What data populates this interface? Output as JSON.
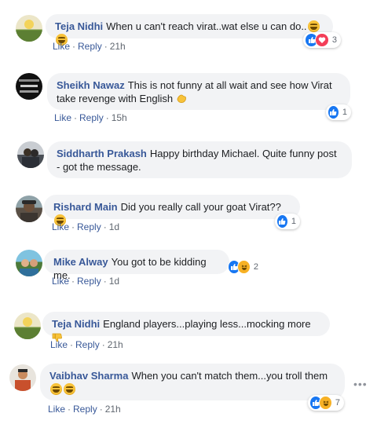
{
  "comments": [
    {
      "author": "Teja Nidhi",
      "text": "When u can't reach virat..wat else u can do..",
      "emoji_suffix": [
        "grinning-sweat",
        "grinning-sweat"
      ],
      "like": "Like",
      "reply": "Reply",
      "time": "21h",
      "reactions": [
        "like",
        "love"
      ],
      "reaction_count": "3",
      "avatar_color": "#6b8f3a"
    },
    {
      "author": "Sheikh Nawaz",
      "text": "This is not funny at all wait and see how Virat take revenge with English",
      "emoji_suffix": [
        "clapping-hands"
      ],
      "like": "Like",
      "reply": "Reply",
      "time": "15h",
      "reactions": [
        "like"
      ],
      "reaction_count": "1",
      "avatar_color": "#111111",
      "avatar_text": "Too Much HAZARD"
    },
    {
      "author": "Siddharth Prakash",
      "text": "Happy birthday Michael. Quite funny post - got the message.",
      "emoji_suffix": [],
      "like": "",
      "reply": "",
      "time": "",
      "reactions": [],
      "reaction_count": "",
      "avatar_color": "#4a4f56"
    },
    {
      "author": "Rishard Main",
      "text": "Did you really call your goat Virat??",
      "emoji_suffix": [
        "grinning-sweat"
      ],
      "like": "Like",
      "reply": "Reply",
      "time": "1d",
      "reactions": [
        "like"
      ],
      "reaction_count": "1",
      "avatar_color": "#5a5046"
    },
    {
      "author": "Mike Alway",
      "text": "You got to be kidding me.",
      "emoji_suffix": [],
      "like": "Like",
      "reply": "Reply",
      "time": "1d",
      "reactions": [
        "like",
        "haha"
      ],
      "reaction_count": "2",
      "avatar_color": "#3d8fb3"
    },
    {
      "author": "Teja Nidhi",
      "text": "England players...playing less...mocking more",
      "emoji_suffix": [
        "thumbs-down"
      ],
      "like": "Like",
      "reply": "Reply",
      "time": "21h",
      "reactions": [],
      "reaction_count": "",
      "avatar_color": "#6b8f3a"
    },
    {
      "author": "Vaibhav Sharma",
      "text": "When you can't match them...you troll them",
      "emoji_suffix": [
        "grinning-sweat",
        "grinning-sweat"
      ],
      "like": "Like",
      "reply": "Reply",
      "time": "21h",
      "reactions": [
        "like",
        "haha"
      ],
      "reaction_count": "7",
      "avatar_color": "#c8502c"
    }
  ],
  "more_options": "•••",
  "colors": {
    "link": "#385898",
    "bubble": "#f2f3f5",
    "like": "#1877f2",
    "love": "#f33e58",
    "haha": "#f7b125"
  }
}
